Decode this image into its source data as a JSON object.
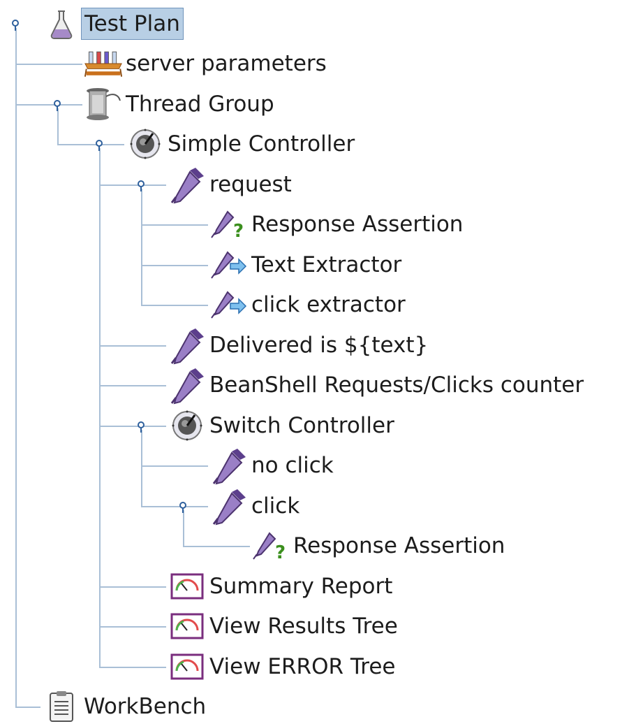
{
  "tree": {
    "nodes": [
      {
        "label": "Test Plan",
        "icon": "flask-icon",
        "level": 0,
        "expanded": true,
        "selected": true
      },
      {
        "label": "server parameters",
        "icon": "test-tubes-icon",
        "level": 1
      },
      {
        "label": "Thread Group",
        "icon": "spool-icon",
        "level": 1,
        "expanded": true
      },
      {
        "label": "Simple Controller",
        "icon": "controller-dial-icon",
        "level": 2,
        "expanded": true
      },
      {
        "label": "request",
        "icon": "pipette-icon",
        "level": 3,
        "expanded": true
      },
      {
        "label": "Response Assertion",
        "icon": "pipette-question-icon",
        "level": 4
      },
      {
        "label": "Text Extractor",
        "icon": "pipette-arrow-icon",
        "level": 4
      },
      {
        "label": "click extractor",
        "icon": "pipette-arrow-icon",
        "level": 4,
        "last": true
      },
      {
        "label": "Delivered is ${text}",
        "icon": "pipette-icon",
        "level": 3
      },
      {
        "label": "BeanShell Requests/Clicks counter",
        "icon": "pipette-icon",
        "level": 3
      },
      {
        "label": "Switch Controller",
        "icon": "controller-dial-icon",
        "level": 3,
        "expanded": true
      },
      {
        "label": "no click",
        "icon": "pipette-icon",
        "level": 4
      },
      {
        "label": "click",
        "icon": "pipette-icon",
        "level": 4,
        "expanded": true
      },
      {
        "label": "Response Assertion",
        "icon": "pipette-question-icon",
        "level": 5,
        "last": true
      },
      {
        "label": "Summary Report",
        "icon": "gauge-report-icon",
        "level": 3
      },
      {
        "label": "View Results Tree",
        "icon": "gauge-report-icon",
        "level": 3
      },
      {
        "label": "View ERROR Tree",
        "icon": "gauge-report-icon",
        "level": 3,
        "last": true
      },
      {
        "label": "WorkBench",
        "icon": "clipboard-icon",
        "level": 0,
        "last": true
      }
    ]
  },
  "colors": {
    "tree_line": "#a9bfd6",
    "handle": "#2d5f9c",
    "selection_bg": "#b8cfe5",
    "pipette": "#7b5aa6"
  }
}
